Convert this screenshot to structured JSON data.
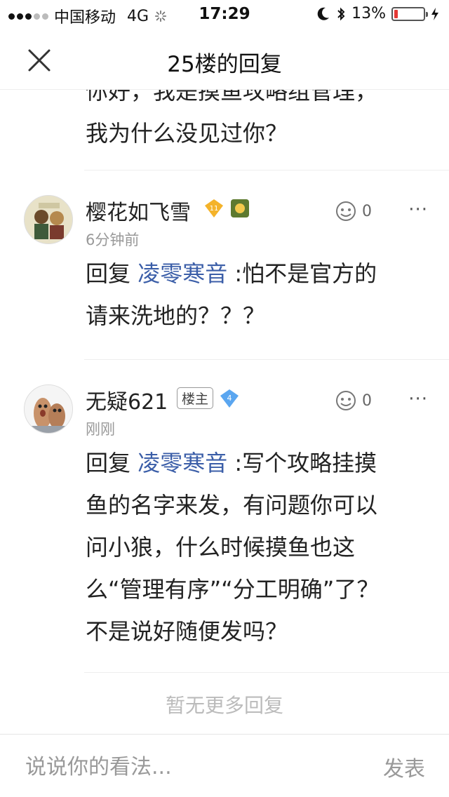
{
  "status_bar": {
    "carrier": "中国移动",
    "network": "4G",
    "time": "17:29",
    "battery_percent": "13%",
    "battery_level": 0.13
  },
  "header": {
    "title": "25楼的回复"
  },
  "partial_text": {
    "line1": "你好，我是摸鱼攻略组管理，",
    "line2": "我为什么没见过你？"
  },
  "replies": [
    {
      "username": "樱花如飞雪",
      "level": "11",
      "time": "6分钟前",
      "likes": "0",
      "prefix": "回复",
      "mention": "凌零寒音",
      "text_line1": ":怕不是官方的",
      "text_line2": "请来洗地的？？？"
    },
    {
      "username": "无疑621",
      "role_badge": "楼主",
      "level": "4",
      "time": "刚刚",
      "likes": "0",
      "prefix": "回复",
      "mention": "凌零寒音",
      "text_line1": ":写个攻略挂摸",
      "text_line2": "鱼的名字来发，有问题你可以",
      "text_line3": "问小狼，什么时候摸鱼也这",
      "text_line4": "么“管理有序”“分工明确”了？",
      "text_line5": "不是说好随便发吗？"
    }
  ],
  "no_more_text": "暂无更多回复",
  "bottom_bar": {
    "placeholder": "说说你的看法...",
    "send_label": "发表"
  },
  "more_label": "···",
  "colors": {
    "mention": "#3b5ea8",
    "muted": "#999999",
    "battery_low": "#e53935"
  }
}
